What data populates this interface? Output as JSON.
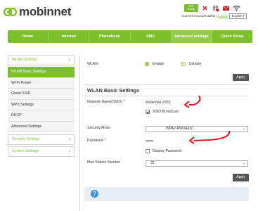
{
  "brand": {
    "name": "mobinnet"
  },
  "header": {
    "sim_badge_line1": "SIM",
    "sim_badge_line2": "Ready",
    "account_text": "Current Account admin",
    "logout_label": "Logout",
    "language": "English"
  },
  "nav": {
    "items": [
      {
        "label": "Home"
      },
      {
        "label": "Internet"
      },
      {
        "label": "Phonebook"
      },
      {
        "label": "SMS"
      },
      {
        "label": "Advanced settings"
      },
      {
        "label": "Quick Setup"
      }
    ]
  },
  "sidebar": {
    "wlan_group": "WLAN Settings",
    "wlan_items": [
      {
        "label": "WLAN Basic Settings"
      },
      {
        "label": "Wi-Fi Power"
      },
      {
        "label": "Guest SSID"
      },
      {
        "label": "WPS Settings"
      },
      {
        "label": "DHCP"
      },
      {
        "label": "Advanced Settings"
      }
    ],
    "security_group": "Security Settings",
    "system_group": "System Settings"
  },
  "wlan": {
    "label": "WLAN",
    "enable_label": "Enable",
    "disable_label": "Disable",
    "selected": "Enable",
    "apply_label": "Apply"
  },
  "basic": {
    "title": "WLAN Basic Settings",
    "network_name_label": "Network Name(SSID)",
    "network_name_value": "MobinNet-3755",
    "ssid_broadcast_label": "SSID Broadcast",
    "ssid_broadcast_checked": true,
    "security_mode_label": "Security Mode",
    "security_mode_value": "WPA2-PSK(AES)",
    "password_label": "Password",
    "password_value": "••••••••",
    "display_password_label": "Display Password",
    "display_password_checked": false,
    "max_station_label": "Max Station Number",
    "max_station_value": "32",
    "apply_label": "Apply",
    "required_mark": "*"
  },
  "colors": {
    "brand_green": "#7cbf2b",
    "annotation_red": "#e0141b",
    "help_blue": "#3b8fd9"
  },
  "icons": {
    "logo": "mobinnet-logo-icon",
    "signal": "signal-x-icon",
    "network": "network-globe-icon",
    "sms": "envelope-icon",
    "wifi": "wifi-icon",
    "help": "help-icon"
  }
}
